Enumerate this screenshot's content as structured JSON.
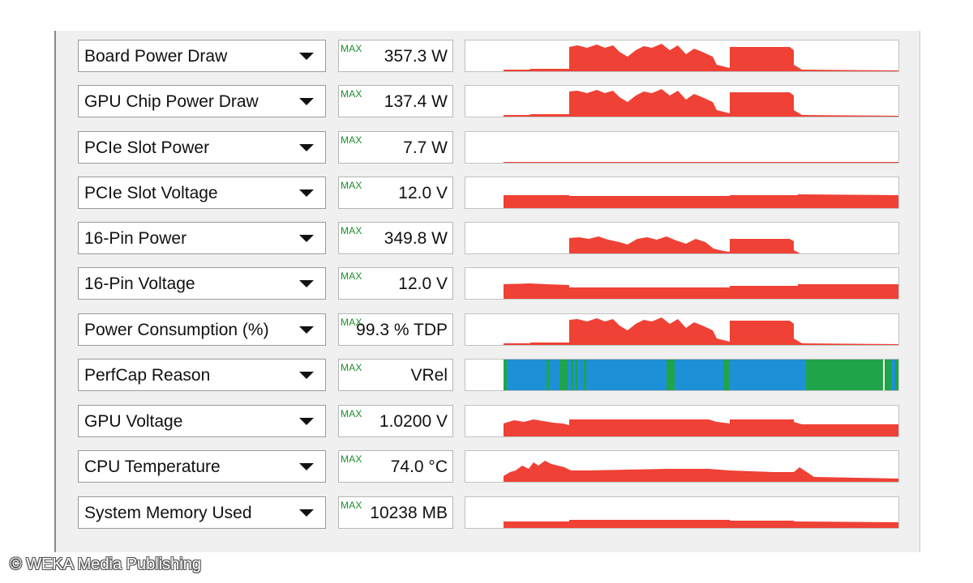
{
  "max_tag": "MAX",
  "colors": {
    "graph": "#ef4135",
    "perfcap_blue": "#1e90d8",
    "perfcap_green": "#1fa44a",
    "max_tag": "#1a8f2a"
  },
  "sensors": [
    {
      "label": "Board Power Draw",
      "value": "357.3 W"
    },
    {
      "label": "GPU Chip Power Draw",
      "value": "137.4 W"
    },
    {
      "label": "PCIe Slot Power",
      "value": "7.7 W"
    },
    {
      "label": "PCIe Slot Voltage",
      "value": "12.0 V"
    },
    {
      "label": "16-Pin Power",
      "value": "349.8 W"
    },
    {
      "label": "16-Pin Voltage",
      "value": "12.0 V"
    },
    {
      "label": "Power Consumption (%)",
      "value": "99.3 % TDP"
    },
    {
      "label": "PerfCap Reason",
      "value": "VRel"
    },
    {
      "label": "GPU Voltage",
      "value": "1.0200 V"
    },
    {
      "label": "CPU Temperature",
      "value": "74.0 °C"
    },
    {
      "label": "System Memory Used",
      "value": "10238 MB"
    }
  ],
  "watermark": "© WEKA Media Publishing"
}
